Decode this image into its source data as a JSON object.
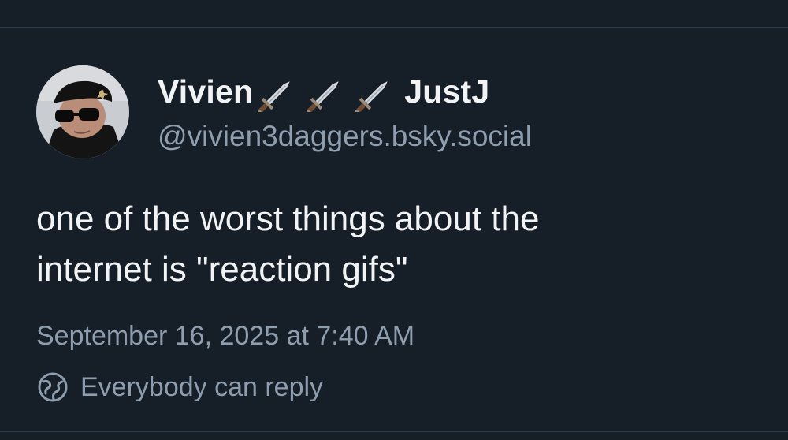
{
  "post": {
    "author": {
      "display_name": "Vivien",
      "display_name_suffix": "JustJ",
      "name_emoji": [
        "dagger-icon",
        "dagger-icon",
        "dagger-icon"
      ],
      "handle": "@vivien3daggers.bsky.social"
    },
    "text_lines": [
      "one of the worst things about the",
      "internet is \"reaction gifs\""
    ],
    "timestamp": "September 16, 2025 at 7:40 AM",
    "reply_setting": {
      "icon": "globe-icon",
      "label": "Everybody can reply"
    }
  },
  "colors": {
    "background": "#161e27",
    "divider": "#2e3b49",
    "primary_text": "#f1f3f5",
    "secondary_text": "#8e9eaf"
  }
}
